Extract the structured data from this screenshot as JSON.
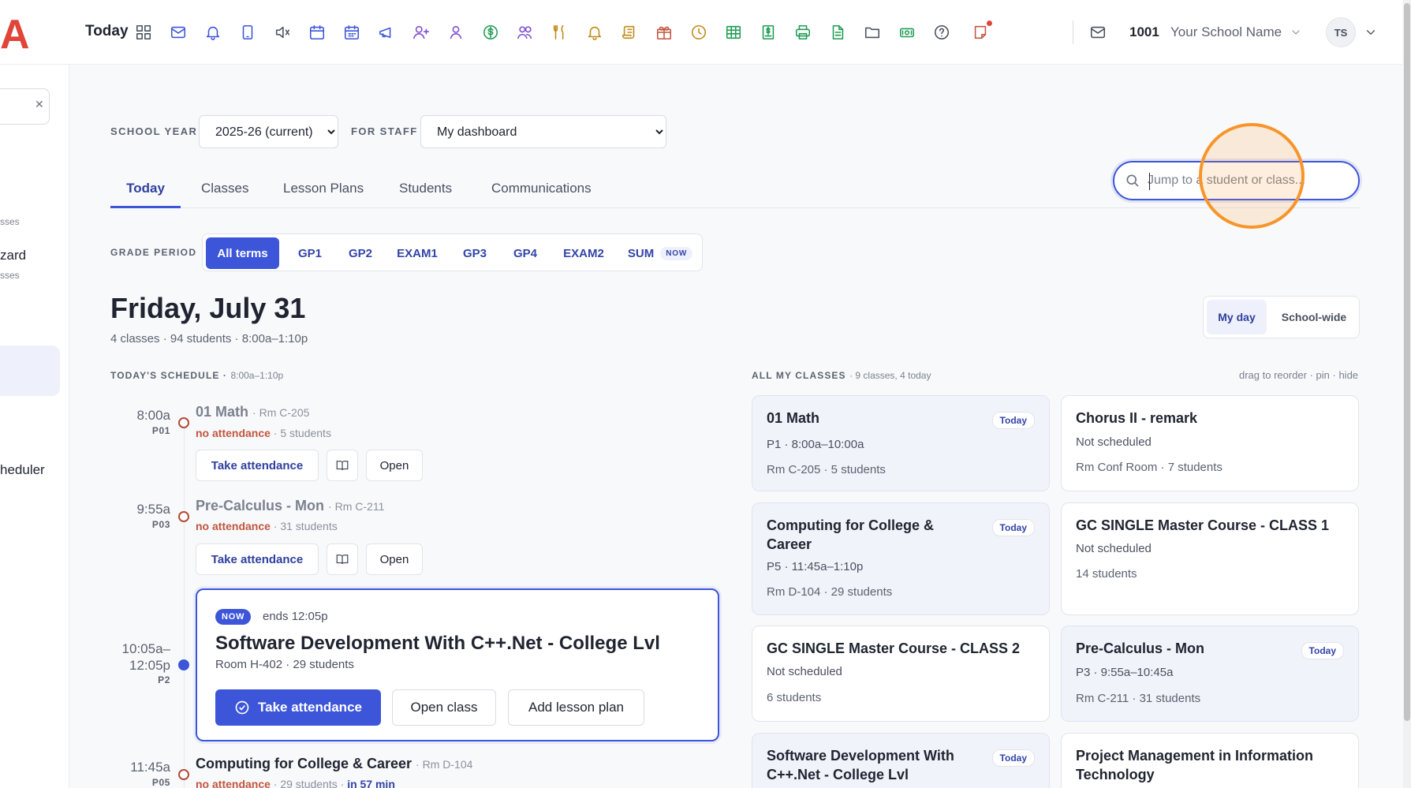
{
  "topbar": {
    "logo": "A",
    "today_label": "Today",
    "school_number": "1001",
    "school_name": "Your School Name",
    "avatar_initials": "TS",
    "icons": [
      "grid-icon",
      "mail-icon",
      "bell-icon",
      "tablet-icon",
      "mute-icon",
      "calendar-icon",
      "calendar-grid-icon",
      "megaphone-icon",
      "add-user-icon",
      "user-icon",
      "dollar-icon",
      "group-icon",
      "utensils-icon",
      "alarm-icon",
      "scroll-icon",
      "gift-icon",
      "clock-icon",
      "table-icon",
      "invoice-icon",
      "printer-icon",
      "document-icon",
      "folder-icon",
      "cash-icon",
      "help-icon",
      "notes-icon"
    ]
  },
  "sidebar": {
    "sub1": "sses",
    "item1": "zard",
    "sub2": "sses",
    "item2": "heduler"
  },
  "filters": {
    "school_year_label": "SCHOOL YEAR",
    "school_year_value": "2025-26 (current)",
    "for_staff_label": "FOR STAFF",
    "for_staff_value": "My dashboard"
  },
  "tabs": [
    "Today",
    "Classes",
    "Lesson Plans",
    "Students",
    "Communications"
  ],
  "search": {
    "placeholder": "Jump to a student or class..."
  },
  "grade_period": {
    "label": "GRADE PERIOD",
    "items": [
      "All terms",
      "GP1",
      "GP2",
      "EXAM1",
      "GP3",
      "GP4",
      "EXAM2",
      "SUM"
    ],
    "now_badge": "NOW"
  },
  "day": {
    "title": "Friday, July 31",
    "summary": "4 classes · 94 students · 8:00a–1:10p",
    "view_my_day": "My day",
    "view_school_wide": "School-wide"
  },
  "schedule": {
    "label": "TODAY'S SCHEDULE",
    "range": "8:00a–1:10p",
    "items": [
      {
        "time": "8:00a",
        "period": "P01",
        "title": "01 Math",
        "room": "· Rm C-205",
        "status": "no attendance",
        "students": "· 5 students"
      },
      {
        "time": "9:55a",
        "period": "P03",
        "title": "Pre-Calculus - Mon",
        "room": "· Rm C-211",
        "status": "no attendance",
        "students": "· 31 students"
      },
      {
        "time": "10:05a–",
        "time2": "12:05p",
        "period": "P2"
      },
      {
        "time": "11:45a",
        "period": "P05",
        "title": "Computing for College & Career",
        "room": "· Rm D-104",
        "status": "no attendance",
        "students": "· 29 students ·",
        "soon": "in 57 min"
      }
    ],
    "take_attendance": "Take attendance",
    "open": "Open",
    "now_card": {
      "tag": "NOW",
      "ends": "ends 12:05p",
      "title": "Software Development With C++.Net - College Lvl",
      "room": "Room H-402 · 29 students",
      "take_attendance": "Take attendance",
      "open_class": "Open class",
      "add_lesson_plan": "Add lesson plan"
    }
  },
  "all_classes": {
    "label": "ALL MY CLASSES",
    "count": "· 9 classes, 4 today",
    "hint": "drag to reorder · pin · hide",
    "cards": [
      {
        "title": "01 Math",
        "badge": "Today",
        "line1": "P1 · 8:00a–10:00a",
        "line2": "Rm C-205 · 5 students"
      },
      {
        "title": "Chorus II - remark",
        "badge": "",
        "line1": "Not scheduled",
        "line2": "Rm Conf Room · 7 students"
      },
      {
        "title": "Computing for College & Career",
        "badge": "Today",
        "line1": "P5 · 11:45a–1:10p",
        "line2": "Rm D-104 · 29 students"
      },
      {
        "title": "GC SINGLE Master Course - CLASS 1",
        "badge": "",
        "line1": "Not scheduled",
        "line2": "14 students"
      },
      {
        "title": "GC SINGLE Master Course - CLASS 2",
        "badge": "",
        "line1": "Not scheduled",
        "line2": "6 students"
      },
      {
        "title": "Pre-Calculus - Mon",
        "badge": "Today",
        "line1": "P3 · 9:55a–10:45a",
        "line2": "Rm C-211 · 31 students"
      },
      {
        "title": "Software Development With C++.Net - College Lvl",
        "badge": "Today",
        "line1": "",
        "line2": ""
      },
      {
        "title": "Project Management in Information Technology",
        "badge": "",
        "line1": "",
        "line2": ""
      }
    ]
  },
  "colors": {
    "accent": "#3c55d9",
    "warn": "#c2563f",
    "brand": "#e0453a",
    "highlight": "#f7952b"
  }
}
